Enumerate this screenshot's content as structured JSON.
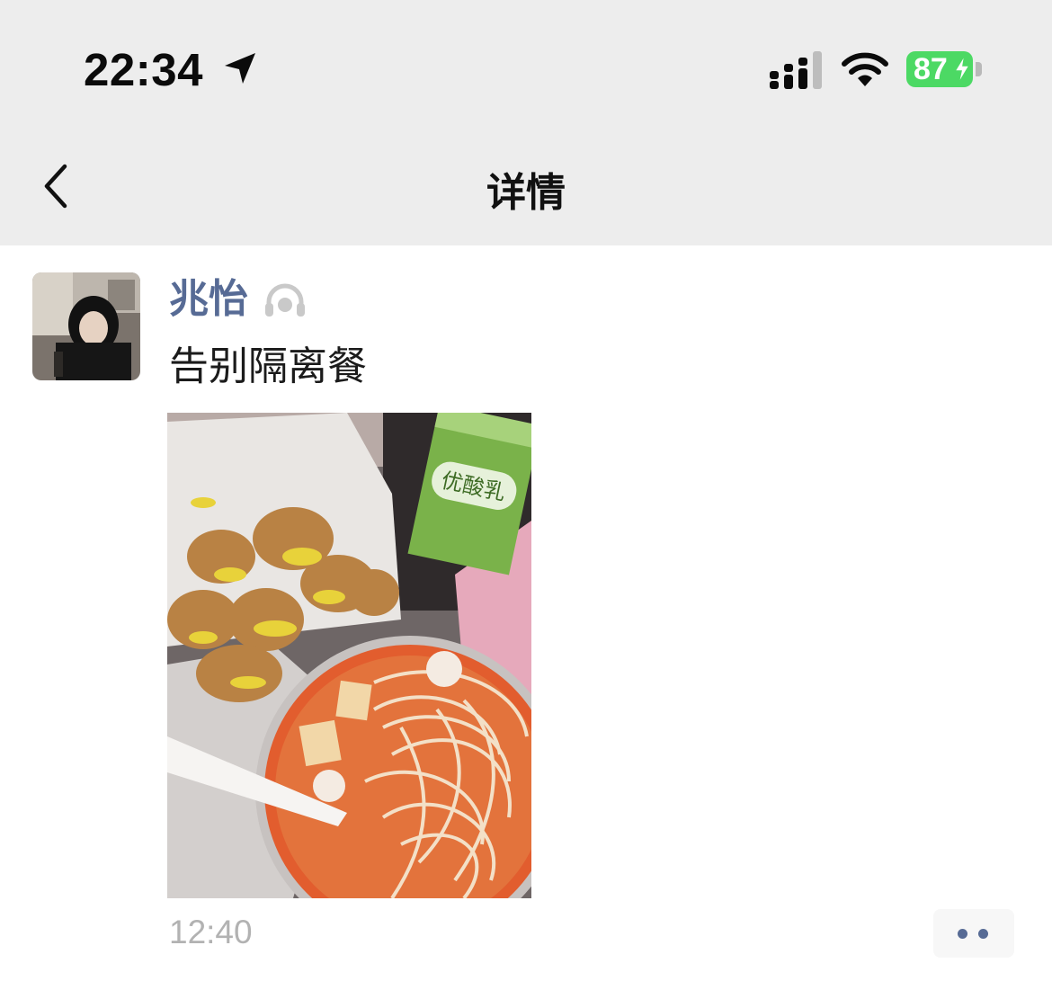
{
  "status_bar": {
    "time": "22:34",
    "battery_level": "87",
    "location_icon": "location-arrow-icon",
    "signal_icon": "cellular-signal-icon",
    "wifi_icon": "wifi-icon",
    "battery_icon": "battery-charging-icon",
    "battery_color": "#4cd964"
  },
  "nav": {
    "title": "详情",
    "back_icon": "chevron-left-icon",
    "background": "#ededed"
  },
  "post": {
    "author": "兆怡",
    "author_color": "#576b95",
    "author_badge_icon": "music-headphones-icon",
    "text": "告别隔离餐",
    "photo_label": "优酸乳",
    "time": "12:40",
    "more_icon": "more-dots-icon"
  }
}
